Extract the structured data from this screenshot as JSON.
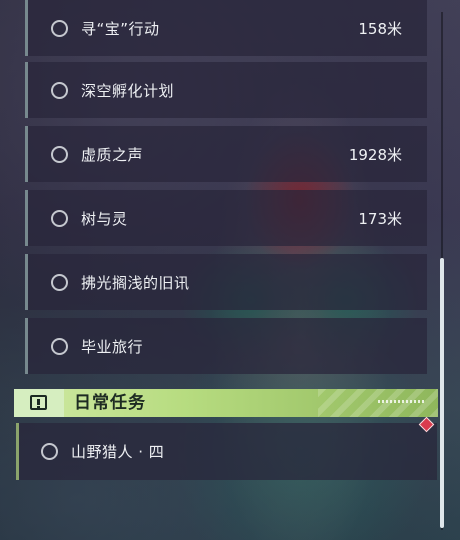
{
  "quests": [
    {
      "name": "寻“宝”行动",
      "distance": "158米"
    },
    {
      "name": "深空孵化计划",
      "distance": ""
    },
    {
      "name": "虚质之声",
      "distance": "1928米"
    },
    {
      "name": "树与灵",
      "distance": "173米"
    },
    {
      "name": "拂光搁浅的旧讯",
      "distance": ""
    },
    {
      "name": "毕业旅行",
      "distance": ""
    }
  ],
  "daily": {
    "title": "日常任务",
    "icon": "alert-icon",
    "quest": {
      "name": "山野猎人 · 四"
    },
    "marker_color": "#d93b4e"
  },
  "colors": {
    "daily_accent": "#b7dc80",
    "panel_bg": "#28263a"
  },
  "scroll": {
    "position": 0.5
  }
}
